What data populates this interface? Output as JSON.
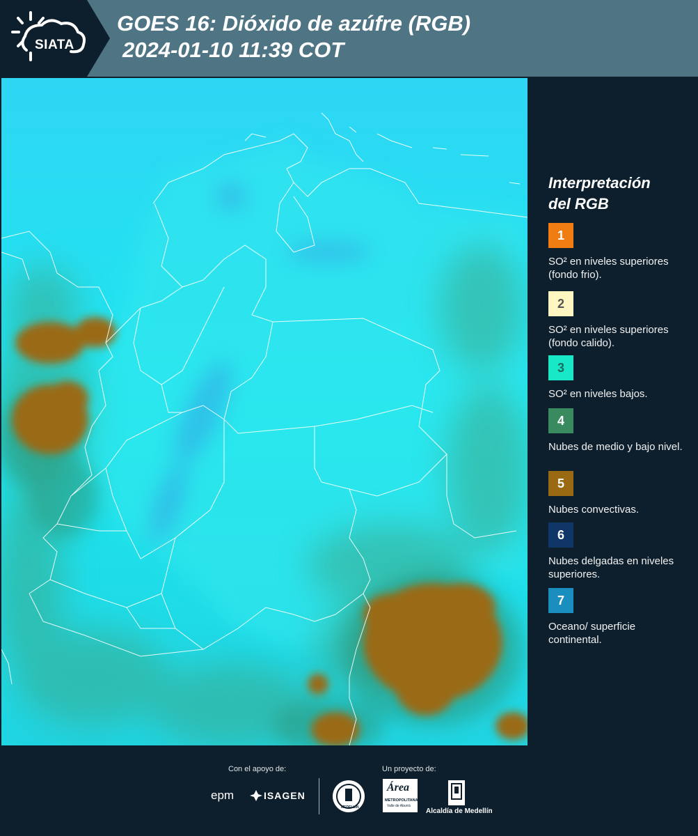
{
  "header": {
    "brand": "SIATA",
    "title_line1": "GOES 16: Dióxido de azúfre (RGB)",
    "title_line2": "2024-01-10 11:39 COT"
  },
  "legend": {
    "title_line1": "Interpretación",
    "title_line2": "del RGB",
    "items": [
      {
        "number": "1",
        "color": "#f07d12",
        "text_color": "#ffffff",
        "label": "SO² en niveles superiores (fondo frio)."
      },
      {
        "number": "2",
        "color": "#fff6c2",
        "text_color": "#555555",
        "label": "SO² en niveles superiores (fondo calido)."
      },
      {
        "number": "3",
        "color": "#19e8c8",
        "text_color": "#1b6b5d",
        "label": "SO² en niveles bajos."
      },
      {
        "number": "4",
        "color": "#3a8a60",
        "text_color": "#ffffff",
        "label": "Nubes de medio y bajo nivel."
      },
      {
        "number": "5",
        "color": "#9a6a12",
        "text_color": "#ffffff",
        "label": "Nubes convectivas."
      },
      {
        "number": "6",
        "color": "#0f3666",
        "text_color": "#ffffff",
        "label": "Nubes delgadas en niveles superiores."
      },
      {
        "number": "7",
        "color": "#1a8fbf",
        "text_color": "#ffffff",
        "label": "Oceano/ superficie continental."
      }
    ]
  },
  "footer": {
    "support_label": "Con el apoyo de:",
    "project_label": "Un proyecto de:",
    "logo_epm": "epm",
    "logo_isagen": "ISAGEN",
    "logo_metro_title": "Área",
    "logo_metro_sub": "METROPOLITANA",
    "logo_metro_sub2": "Valle de Aburrá",
    "logo_medellin_seal": "MEDELLÍN",
    "logo_alcaldia": "Alcaldía de Medellín"
  },
  "colors": {
    "background": "#0d1f2c",
    "header_band": "#4f7585",
    "map_cyan": "#1ee6ee",
    "convective": "#9a6a12",
    "mid_low_clouds": "#3a8a60"
  }
}
